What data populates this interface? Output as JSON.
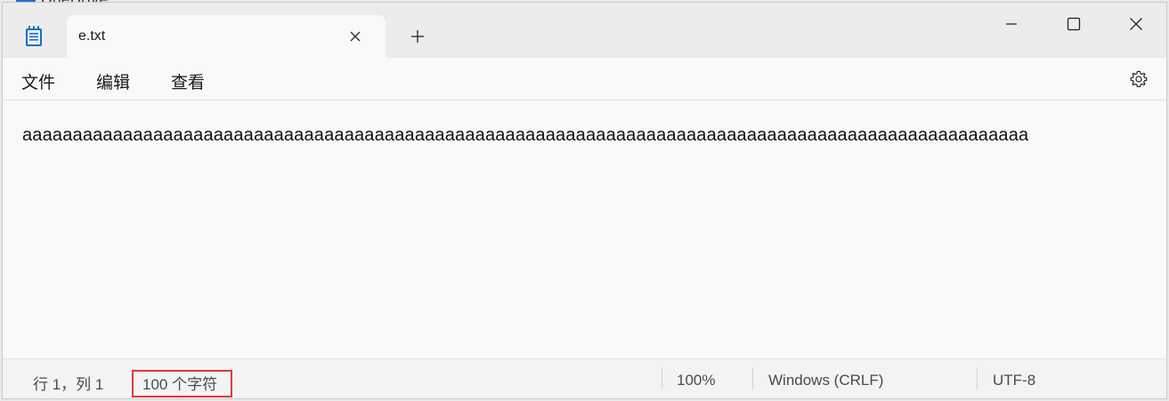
{
  "background": {
    "app_label": "OneDrive"
  },
  "window": {
    "tab": {
      "title": "e.txt"
    },
    "menu": {
      "items": [
        "文件",
        "编辑",
        "查看"
      ]
    },
    "editor": {
      "content": "aaaaaaaaaaaaaaaaaaaaaaaaaaaaaaaaaaaaaaaaaaaaaaaaaaaaaaaaaaaaaaaaaaaaaaaaaaaaaaaaaaaaaaaaaaaaaaaaaaaa"
    },
    "status": {
      "position": "行 1，列 1",
      "char_count": "100 个字符",
      "zoom": "100%",
      "line_ending": "Windows (CRLF)",
      "encoding": "UTF-8"
    }
  },
  "icons": {
    "app": "notepad-icon",
    "close_tab": "close-icon",
    "new_tab": "plus-icon",
    "minimize": "minimize-icon",
    "maximize": "maximize-icon",
    "close_window": "close-icon",
    "settings": "gear-icon"
  },
  "colors": {
    "highlight": "#e03a3a",
    "titlebar": "#ececec",
    "editor_bg": "#f9f9f9",
    "app_icon_blue": "#1f6fc5"
  }
}
